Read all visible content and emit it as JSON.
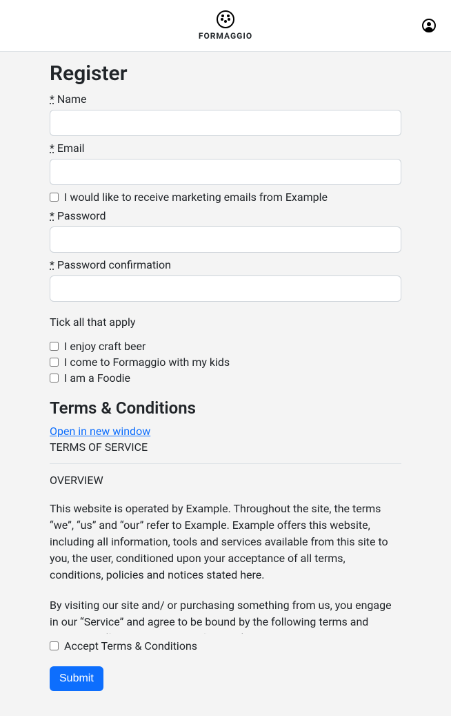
{
  "header": {
    "brand": "FORMAGGIO"
  },
  "page": {
    "title": "Register"
  },
  "form": {
    "required_mark": "*",
    "name_label": "Name",
    "email_label": "Email",
    "marketing_label": "I would like to receive marketing emails from Example",
    "password_label": "Password",
    "password_confirm_label": "Password confirmation",
    "tick_label": "Tick all that apply",
    "options": [
      "I enjoy craft beer",
      "I come to Formaggio with my kids",
      "I am a Foodie"
    ],
    "accept_terms_label": "Accept Terms & Conditions",
    "submit_label": "Submit"
  },
  "terms": {
    "heading": "Terms & Conditions",
    "open_link": "Open in new window",
    "service_title": "TERMS OF SERVICE",
    "overview_title": "OVERVIEW",
    "paragraph1": "This website is operated by Example. Throughout the site, the terms “we”, “us” and “our” refer to Example. Example offers this website, including all information, tools and services available from this site to you, the user, conditioned upon your acceptance of all terms, conditions, policies and notices stated here.",
    "paragraph2": "By visiting our site and/ or purchasing something from us, you engage in our “Service” and agree to be bound by the following terms and conditions (“Terms of Service”, “Terms”), including those"
  }
}
